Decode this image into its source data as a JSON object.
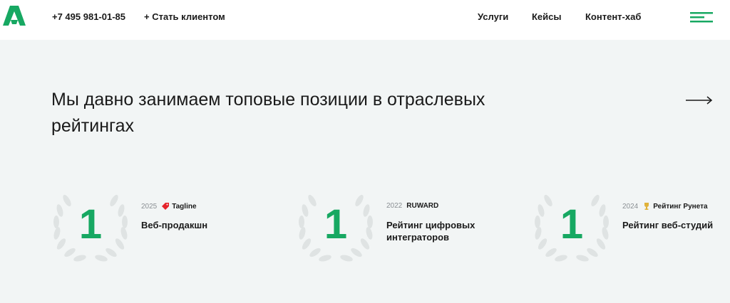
{
  "header": {
    "logo": "logo-icon",
    "phone": "+7 495 981-01-85",
    "become_client": "+ Стать клиентом",
    "nav": {
      "services": "Услуги",
      "cases": "Кейсы",
      "content_hub": "Контент-хаб"
    },
    "menu_icon": "burger-menu-icon"
  },
  "section": {
    "title": "Мы давно занимаем топовые позиции в отраслевых рейтингах",
    "arrow_icon": "arrow-right-icon"
  },
  "awards": [
    {
      "place": "1",
      "year": "2025",
      "source": "Tagline",
      "source_icon": "tagline-tag-icon",
      "name": "Веб-продакшн"
    },
    {
      "place": "1",
      "year": "2022",
      "source": "RUWARD",
      "source_icon": "",
      "name": "Рейтинг цифровых интеграторов"
    },
    {
      "place": "1",
      "year": "2024",
      "source": "Рейтинг Рунета",
      "source_icon": "runet-cup-icon",
      "name": "Рейтинг веб-студий"
    }
  ],
  "colors": {
    "accent": "#17a862",
    "background": "#f2f5f5",
    "header_bg": "#ffffff",
    "text": "#1a1a1a",
    "muted": "#8a8f93",
    "laurel": "#dfe3e3"
  }
}
